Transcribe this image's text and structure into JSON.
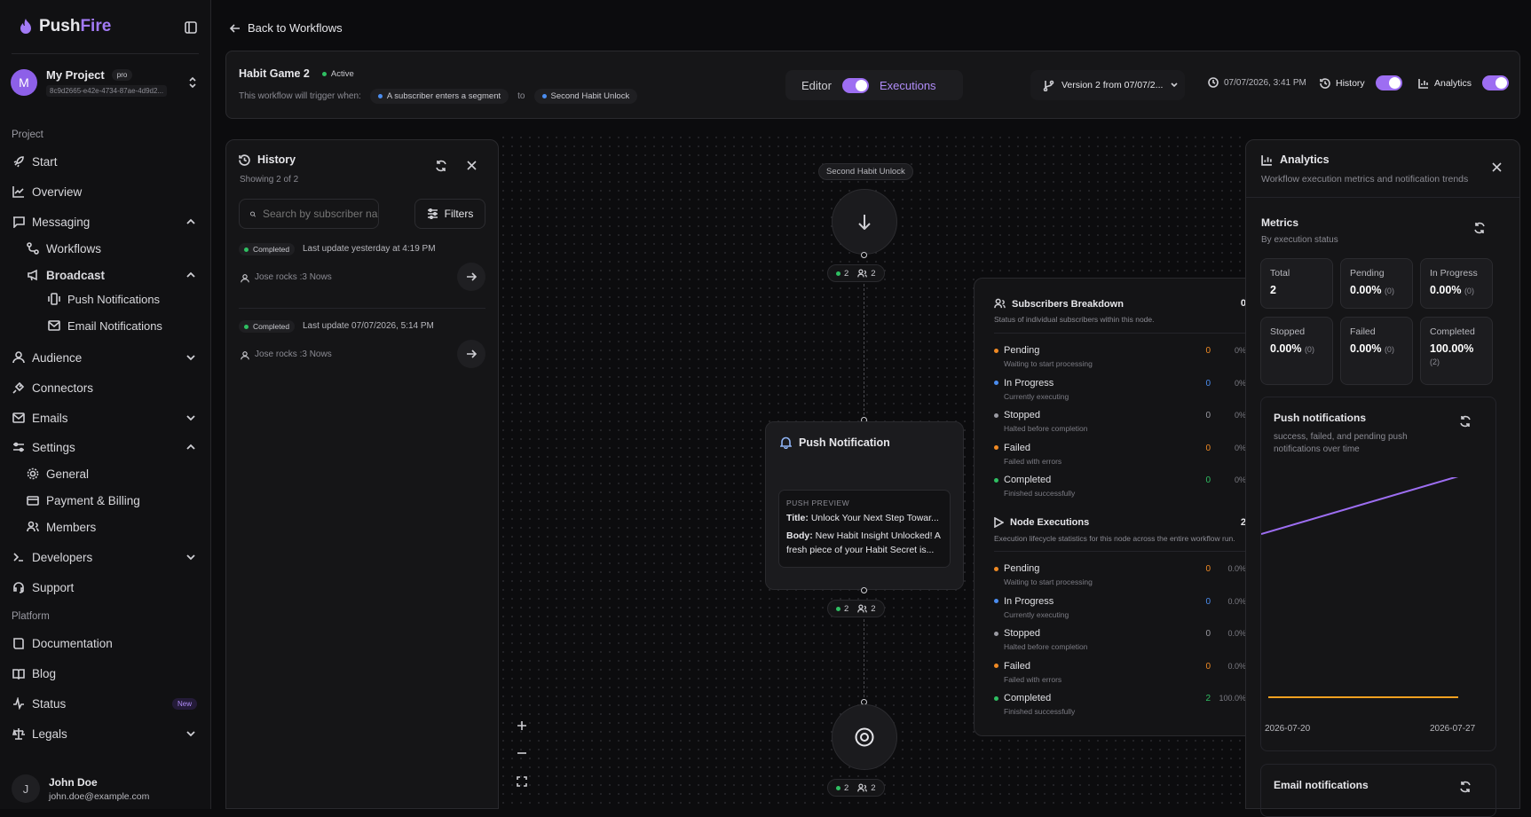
{
  "app": {
    "brand_a": "Push",
    "brand_b": "Fire"
  },
  "project": {
    "name": "My Project",
    "plan": "pro",
    "id": "8c9d2665-e42e-4734-87ae-4d9d2..."
  },
  "sidebar": {
    "section_project": "Project",
    "section_platform": "Platform",
    "start": "Start",
    "overview": "Overview",
    "messaging": "Messaging",
    "workflows": "Workflows",
    "broadcast": "Broadcast",
    "push_notifications": "Push Notifications",
    "email_notifications": "Email Notifications",
    "audience": "Audience",
    "connectors": "Connectors",
    "emails": "Emails",
    "settings": "Settings",
    "general": "General",
    "payment": "Payment & Billing",
    "members": "Members",
    "developers": "Developers",
    "support": "Support",
    "documentation": "Documentation",
    "blog": "Blog",
    "status": "Status",
    "status_badge": "New",
    "legals": "Legals"
  },
  "user": {
    "initial": "J",
    "name": "John Doe",
    "email": "john.doe@example.com"
  },
  "back_label": "Back to Workflows",
  "workflow": {
    "name": "Habit Game 2",
    "status": "Active",
    "trigger_prefix": "This workflow will trigger when:",
    "trigger_event": "A subscriber enters a segment",
    "trigger_to": "to",
    "trigger_target": "Second Habit Unlock"
  },
  "modes": {
    "editor": "Editor",
    "executions": "Executions"
  },
  "version": "Version 2 from 07/07/2...",
  "timestamp": "07/07/2026, 3:41 PM",
  "toggles": {
    "history": "History",
    "analytics": "Analytics"
  },
  "history": {
    "title": "History",
    "showing": "Showing 2 of 2",
    "search_placeholder": "Search by subscriber name",
    "filters": "Filters",
    "items": [
      {
        "status": "Completed",
        "update": "Last update yesterday at 4:19 PM",
        "subscriber": "Jose rocks :3 Nows"
      },
      {
        "status": "Completed",
        "update": "Last update 07/07/2026, 5:14 PM",
        "subscriber": "Jose rocks :3 Nows"
      }
    ]
  },
  "flow": {
    "trigger_label": "Second Habit Unlock",
    "stat_a": "2",
    "stat_b": "2",
    "push_title": "Push Notification",
    "preview_label": "PUSH PREVIEW",
    "preview_title_key": "Title:",
    "preview_title": "Unlock Your Next Step Towar...",
    "preview_body_key": "Body:",
    "preview_body": "New Habit Insight Unlocked! A fresh piece of your Habit Secret is..."
  },
  "breakdown": {
    "title": "Subscribers Breakdown",
    "count": "0",
    "subtitle": "Status of individual subscribers within this node.",
    "rows": [
      {
        "name": "Pending",
        "desc": "Waiting to start processing",
        "count": "0",
        "pct": "0%"
      },
      {
        "name": "In Progress",
        "desc": "Currently executing",
        "count": "0",
        "pct": "0%"
      },
      {
        "name": "Stopped",
        "desc": "Halted before completion",
        "count": "0",
        "pct": "0%"
      },
      {
        "name": "Failed",
        "desc": "Failed with errors",
        "count": "0",
        "pct": "0%"
      },
      {
        "name": "Completed",
        "desc": "Finished successfully",
        "count": "0",
        "pct": "0%"
      }
    ],
    "exec_title": "Node Executions",
    "exec_count": "2",
    "exec_subtitle": "Execution lifecycle statistics for this node across the entire workflow run.",
    "exec_rows": [
      {
        "name": "Pending",
        "desc": "Waiting to start processing",
        "count": "0",
        "pct": "0.0%"
      },
      {
        "name": "In Progress",
        "desc": "Currently executing",
        "count": "0",
        "pct": "0.0%"
      },
      {
        "name": "Stopped",
        "desc": "Halted before completion",
        "count": "0",
        "pct": "0.0%"
      },
      {
        "name": "Failed",
        "desc": "Failed with errors",
        "count": "0",
        "pct": "0.0%"
      },
      {
        "name": "Completed",
        "desc": "Finished successfully",
        "count": "2",
        "pct": "100.0%"
      }
    ]
  },
  "colors": {
    "pending": "#f08a24",
    "in_progress": "#4b8df0",
    "stopped": "#9a9aa2",
    "failed": "#f08a24",
    "completed": "#2fbf62",
    "accent": "#9d6ef2"
  },
  "analytics": {
    "title": "Analytics",
    "subtitle": "Workflow execution metrics and notification trends",
    "metrics_title": "Metrics",
    "metrics_sub": "By execution status",
    "cards": [
      {
        "label": "Total",
        "value": "2",
        "count": ""
      },
      {
        "label": "Pending",
        "value": "0.00%",
        "count": "(0)"
      },
      {
        "label": "In Progress",
        "value": "0.00%",
        "count": "(0)"
      },
      {
        "label": "Stopped",
        "value": "0.00%",
        "count": "(0)"
      },
      {
        "label": "Failed",
        "value": "0.00%",
        "count": "(0)"
      },
      {
        "label": "Completed",
        "value": "100.00%",
        "count": "(2)"
      }
    ],
    "push_title": "Push notifications",
    "push_sub": "success, failed, and pending push notifications over time",
    "email_title": "Email notifications"
  },
  "chart_data": {
    "type": "line",
    "x": [
      "2026-07-20",
      "2026-07-27"
    ],
    "tick_labels": [
      "2026-07-20",
      "2026-07-27"
    ],
    "series": [
      {
        "values": [
          null,
          null
        ],
        "color": "#9d6ef2"
      },
      {
        "values": [
          0,
          0
        ],
        "color": "#f0a020"
      }
    ],
    "grid": false
  }
}
